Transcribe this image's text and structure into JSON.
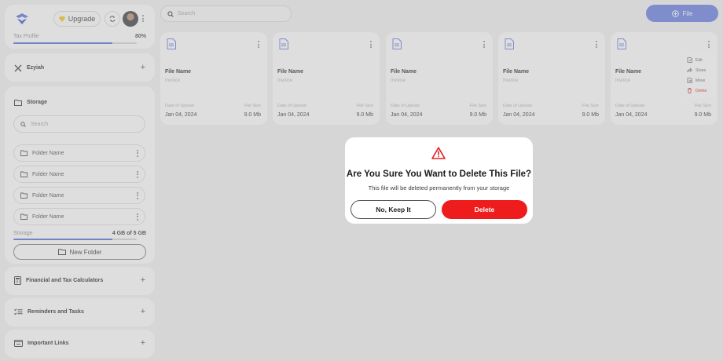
{
  "profile": {
    "upgrade_label": "Upgrade",
    "tax_profile_label": "Tax Profile",
    "tax_profile_percent": "80%",
    "tax_profile_progress": 0.8
  },
  "sections": {
    "ezyiah": "Ezyiah",
    "storage": "Storage",
    "calculators": "Financial and Tax Calculators",
    "reminders": "Reminders and Tasks",
    "links": "Important Links"
  },
  "storage": {
    "search_placeholder": "Search",
    "folders": [
      "Folder Name",
      "Folder Name",
      "Folder Name",
      "Folder Name"
    ],
    "usage_label": "Storage",
    "usage_value": "4 GB of 5  GB",
    "usage_progress": 0.8,
    "new_folder_label": "New Folder"
  },
  "topbar": {
    "search_placeholder": "Search",
    "file_button_label": "File"
  },
  "files": [
    {
      "name": "File Name",
      "type": "Invoice",
      "date_label": "Date of Upload",
      "size_label": "File Size",
      "date": "Jan 04, 2024",
      "size": "9.0 Mb"
    },
    {
      "name": "File Name",
      "type": "Invoice",
      "date_label": "Date of Upload",
      "size_label": "File Size",
      "date": "Jan 04, 2024",
      "size": "9.0 Mb"
    },
    {
      "name": "File Name",
      "type": "Invoice",
      "date_label": "Date of Upload",
      "size_label": "File Size",
      "date": "Jan 04, 2024",
      "size": "9.0 Mb"
    },
    {
      "name": "File Name",
      "type": "Invoice",
      "date_label": "Date of Upload",
      "size_label": "File Size",
      "date": "Jan 04, 2024",
      "size": "9.0 Mb"
    },
    {
      "name": "File Name",
      "type": "Invoice",
      "date_label": "Date of Upload",
      "size_label": "File Size",
      "date": "Jan 04, 2024",
      "size": "9.0 Mb"
    }
  ],
  "context_menu": {
    "edit": "Edit",
    "share": "Share",
    "move": "Move",
    "delete": "Delete"
  },
  "modal": {
    "title": "Are You Sure You Want to Delete This File?",
    "message": "This file will be deleted permanently from your storage",
    "cancel_label": "No, Keep It",
    "confirm_label": "Delete"
  },
  "colors": {
    "accent": "#7a8bd8",
    "danger": "#ee1c1c",
    "background": "#e4e4e4"
  }
}
